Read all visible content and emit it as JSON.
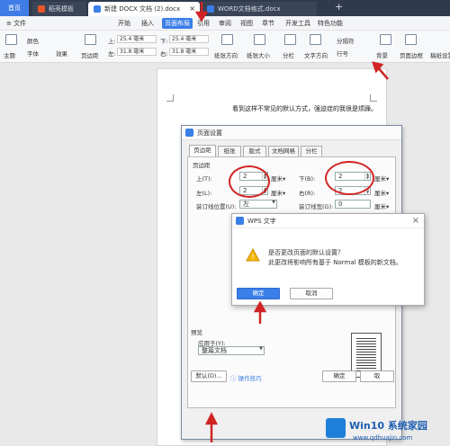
{
  "tabs": {
    "home": "首页",
    "t1": "稻壳模板",
    "t2": "新建 DOCX 文档 (2).docx",
    "t3": "WORD文档格式.docx",
    "plus": "+"
  },
  "menubar": {
    "file": "≡ 文件",
    "items": [
      "开始",
      "插入",
      "页面布局",
      "引用",
      "审阅",
      "视图",
      "章节",
      "开发工具",
      "特色功能"
    ],
    "active": "页面布局"
  },
  "ribbon": {
    "theme": "主题",
    "color": "颜色",
    "font": "字体",
    "effect": "效果",
    "margins": "页边距",
    "top_label": "上:",
    "top_val": "25.4 毫米",
    "bottom_label": "下:",
    "bottom_val": "25.4 毫米",
    "left_label": "左:",
    "left_val": "31.8 毫米",
    "right_label": "右:",
    "right_val": "31.8 毫米",
    "orientation": "纸张方向",
    "size": "纸张大小",
    "columns": "分栏",
    "textdir": "文字方向",
    "linenum": "行号",
    "separator": "分隔符",
    "background": "背景",
    "border": "页面边框",
    "dribbon": "稿纸设置"
  },
  "doc": {
    "text": "看到这样不常见的默认方式，强迫症的我很是烦躁。"
  },
  "page_setup": {
    "title": "页面设置",
    "tabs": [
      "页边距",
      "纸张",
      "版式",
      "文档网格",
      "分栏"
    ],
    "section": "页边距",
    "top_label": "上(T):",
    "top_val": "2",
    "bottom_label": "下(B):",
    "bottom_val": "2",
    "left_label": "左(L):",
    "left_val": "2",
    "right_label": "右(R):",
    "right_val": "2",
    "unit": "厘米▾",
    "gutter_pos_label": "装订线位置(U):",
    "gutter_pos_val": "左",
    "gutter_label": "装订线宽(G):",
    "gutter_val": "0",
    "preview_label": "预览",
    "apply_label": "应用于(Y):",
    "apply_val": "整篇文档",
    "default_btn": "默认(D)...",
    "tips": "操作技巧",
    "ok": "确定",
    "cancel": "取"
  },
  "wps_dialog": {
    "title": "WPS 文字",
    "q": "是否更改页面的默认设置？",
    "desc": "此更改将影响所有基于 Normal 模板的新文档。",
    "ok": "确定",
    "cancel": "取消",
    "close": "×",
    "warn": "!"
  },
  "watermark": {
    "brand": "Win10 系统家园",
    "url": "www.qdhuajin.com"
  },
  "colors": {
    "accent": "#3a7ee8",
    "red": "#d12424"
  }
}
